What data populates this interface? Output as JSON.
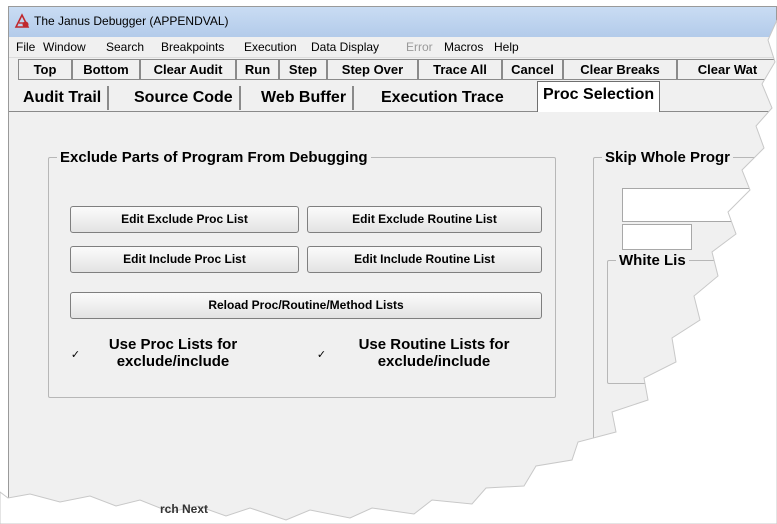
{
  "window": {
    "title": "The Janus Debugger (APPENDVAL)"
  },
  "menu": [
    {
      "label": "File",
      "disabled": false
    },
    {
      "label": "Window",
      "disabled": false
    },
    {
      "label": "Search",
      "disabled": false
    },
    {
      "label": "Breakpoints",
      "disabled": false
    },
    {
      "label": "Execution",
      "disabled": false
    },
    {
      "label": "Data Display",
      "disabled": false
    },
    {
      "label": "Error",
      "disabled": true
    },
    {
      "label": "Macros",
      "disabled": false
    },
    {
      "label": "Help",
      "disabled": false
    }
  ],
  "toolbar": [
    "Top",
    "Bottom",
    "Clear Audit",
    "Run",
    "Step",
    "Step Over",
    "Trace All",
    "Cancel",
    "Clear Breaks",
    "Clear Wat"
  ],
  "tabs": [
    {
      "label": "Audit Trail",
      "active": false
    },
    {
      "label": "Source Code",
      "active": false
    },
    {
      "label": "Web Buffer",
      "active": false
    },
    {
      "label": "Execution Trace",
      "active": false
    },
    {
      "label": "Proc Selection",
      "active": true
    }
  ],
  "exclude_group": {
    "title": "Exclude Parts of Program From Debugging",
    "edit_exclude_proc": "Edit Exclude Proc List",
    "edit_exclude_routine": "Edit Exclude Routine List",
    "edit_include_proc": "Edit Include Proc List",
    "edit_include_routine": "Edit Include Routine List",
    "reload": "Reload Proc/Routine/Method Lists",
    "use_proc_lists": {
      "line1": "Use Proc Lists for",
      "line2": "exclude/include",
      "checked": true,
      "mark": "✓"
    },
    "use_routine_lists": {
      "line1": "Use Routine Lists for",
      "line2": "exclude/include",
      "checked": true,
      "mark": "✓"
    }
  },
  "skip_group": {
    "title": "Skip Whole Progr",
    "white_list": "White Lis"
  },
  "status_fragment": "rch Next",
  "colors": {
    "titlebar": "#c9dcf3",
    "panel": "#f0f0f0"
  }
}
